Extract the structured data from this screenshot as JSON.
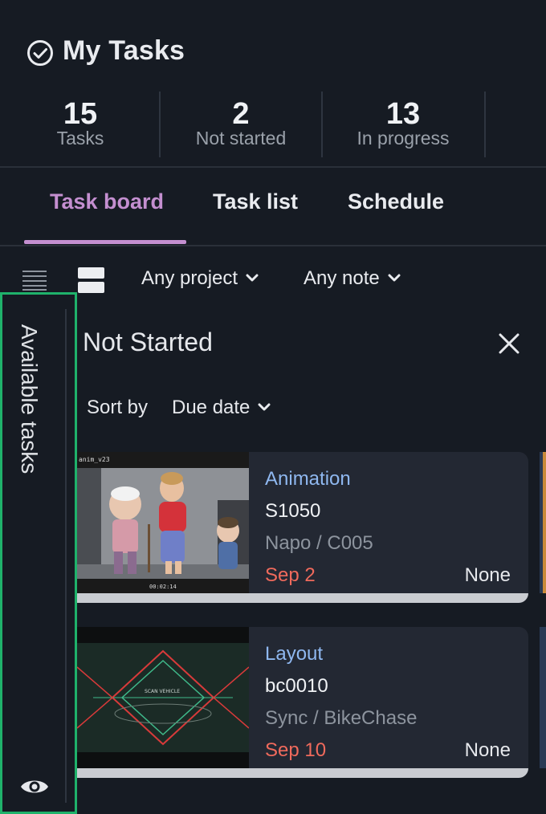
{
  "header": {
    "title": "My Tasks"
  },
  "stats": [
    {
      "value": "15",
      "label": "Tasks"
    },
    {
      "value": "2",
      "label": "Not started"
    },
    {
      "value": "13",
      "label": "In progress"
    }
  ],
  "tabs": [
    {
      "label": "Task board",
      "active": true
    },
    {
      "label": "Task list",
      "active": false
    },
    {
      "label": "Schedule",
      "active": false
    }
  ],
  "filters": {
    "project": "Any project",
    "note": "Any note"
  },
  "sidebar": {
    "label": "Available tasks"
  },
  "column": {
    "title": "Not Started",
    "sort_label": "Sort by",
    "sort_value": "Due date"
  },
  "cards": [
    {
      "type": "Animation",
      "name": "S1050",
      "project": "Napo / C005",
      "due": "Sep 2",
      "priority": "None",
      "thumb_label": "anim_v23",
      "thumb_time": "00:02:14"
    },
    {
      "type": "Layout",
      "name": "bc0010",
      "project": "Sync / BikeChase",
      "due": "Sep 10",
      "priority": "None",
      "thumb_label": "SCAN VEHICLE"
    }
  ],
  "colors": {
    "accent_tab": "#c48fd0",
    "task_type": "#8fb8f0",
    "due_date": "#f06a5c",
    "sidebar_highlight": "#1fb26b",
    "background": "#161b23"
  }
}
